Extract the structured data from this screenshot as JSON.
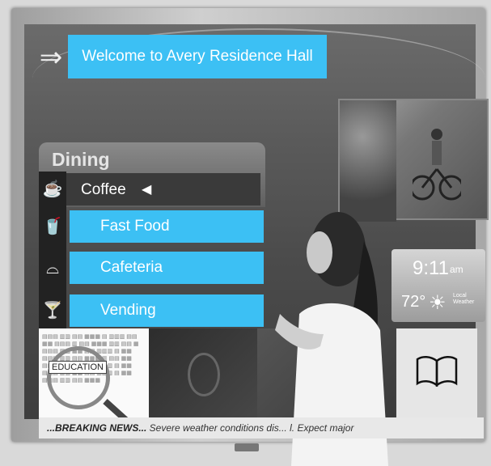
{
  "welcome": {
    "text": "Welcome to Avery Residence Hall"
  },
  "dining": {
    "title": "Dining",
    "coffee_label": "Coffee",
    "coffee_arrow": "◀",
    "options": [
      {
        "label": "Fast Food",
        "icon": "soda-cup-icon"
      },
      {
        "label": "Cafeteria",
        "icon": "cloche-icon"
      },
      {
        "label": "Vending",
        "icon": "cocktail-icon"
      }
    ],
    "coffee_icon": "coffee-cup-icon"
  },
  "weather": {
    "time": "9:11",
    "ampm": "am",
    "temperature": "72°",
    "label": "Local Weather"
  },
  "tiles": {
    "education_label": "EDUCATION"
  },
  "ticker": {
    "headline": "...BREAKING NEWS...",
    "text": " Severe weather conditions dis...                  l. Expect major"
  },
  "colors": {
    "accent": "#3cc0f4",
    "background": "#4b4b4b"
  }
}
